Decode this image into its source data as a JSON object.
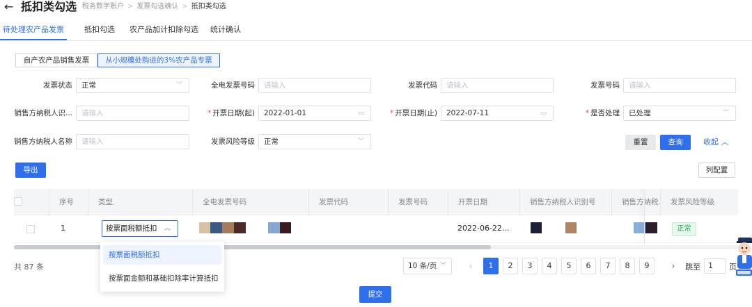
{
  "header": {
    "title": "抵扣类勾选",
    "breadcrumb": [
      "税务数字账户",
      "发票勾选确认",
      "抵扣类勾选"
    ]
  },
  "tabs": [
    {
      "label": "待处理农产品发票",
      "active": true
    },
    {
      "label": "抵扣勾选",
      "active": false
    },
    {
      "label": "农产品加计扣除勾选",
      "active": false
    },
    {
      "label": "统计确认",
      "active": false
    }
  ],
  "segments": [
    {
      "label": "自产农产品销售发票",
      "active": false
    },
    {
      "label": "从小规模处购进的3%农产品专票",
      "active": true
    }
  ],
  "filters": {
    "invoice_status": {
      "label": "发票状态",
      "value": "正常"
    },
    "elec_invoice_no": {
      "label": "全电发票号码",
      "placeholder": "请输入"
    },
    "invoice_code": {
      "label": "发票代码",
      "placeholder": "请输入"
    },
    "invoice_no": {
      "label": "发票号码",
      "placeholder": "请输入"
    },
    "seller_taxid": {
      "label": "销售方纳税人识...",
      "placeholder": "请输入"
    },
    "date_start": {
      "label": "开票日期(起)",
      "value": "2022-01-01"
    },
    "date_end": {
      "label": "开票日期(止)",
      "value": "2022-07-11"
    },
    "processed": {
      "label": "是否处理",
      "value": "已处理"
    },
    "seller_name": {
      "label": "销售方纳税人名称",
      "placeholder": "请输入"
    },
    "risk_level": {
      "label": "发票风险等级",
      "value": "正常"
    }
  },
  "actions": {
    "reset": "重置",
    "query": "查询",
    "collapse": "收起",
    "export": "导出",
    "columns": "列配置",
    "submit": "提交"
  },
  "table": {
    "columns": [
      "序号",
      "类型",
      "全电发票号码",
      "发票代码",
      "发票号码",
      "开票日期",
      "销售方纳税人识别号",
      "销售方纳税...",
      "发票风险等级"
    ],
    "rows": [
      {
        "index": "1",
        "type": "按票面税额抵扣",
        "date": "2022-06-22...",
        "risk": "正常"
      }
    ]
  },
  "dropdown": {
    "options": [
      "按票面税额抵扣",
      "按票面金额和基础扣除率计算抵扣"
    ],
    "selected_index": 0
  },
  "pagination": {
    "total": "共 87 条",
    "page_size": "10 条/页",
    "pages": [
      "1",
      "2",
      "3",
      "4",
      "5",
      "6",
      "7",
      "8",
      "9"
    ],
    "current": 1,
    "jump_label": "跳至",
    "jump_value": "1",
    "page_suffix": "页"
  },
  "colors": {
    "primary": "#2f6feb",
    "success": "#22a55b",
    "required": "#f04438"
  },
  "masked_blocks": [
    "#d8c2a6",
    "#3b5a84",
    "#a57b5a",
    "#4a2a26",
    "#85a8d1",
    "#3b1a20",
    "#1b1f3a",
    "#b08566",
    "#8aaedc",
    "#2c1e2a"
  ]
}
